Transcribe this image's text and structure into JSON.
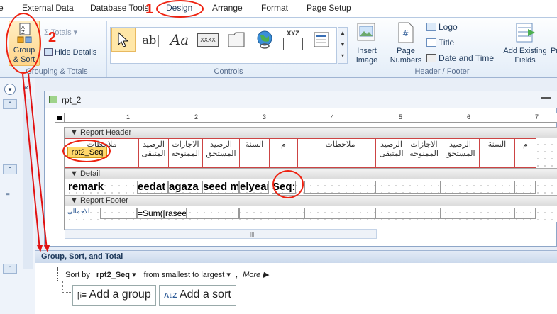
{
  "ribbon_tabs": [
    {
      "label": "e"
    },
    {
      "label": "External Data"
    },
    {
      "label": "Database Tools"
    },
    {
      "label": "Design"
    },
    {
      "label": "Arrange"
    },
    {
      "label": "Format"
    },
    {
      "label": "Page Setup"
    }
  ],
  "grouping": {
    "group_sort_label": "Group\n& Sort",
    "totals_label": "Totals",
    "hide_details_label": "Hide Details",
    "group_name": "Grouping & Totals"
  },
  "controls": {
    "group_name": "Controls",
    "textbox_label": "ab|",
    "label_label": "Aa",
    "button_label": "XXXX",
    "xyz_label": "XYZ",
    "insert_image_label": "Insert\nImage"
  },
  "header_footer": {
    "group_name": "Header / Footer",
    "page_numbers_label": "Page\nNumbers",
    "logo_label": "Logo",
    "title_label": "Title",
    "date_time_label": "Date and Time"
  },
  "tools": {
    "add_existing_fields_label": "Add Existing\nFields",
    "partial_label": "Pr"
  },
  "report": {
    "window_title": "rpt_2",
    "ruler_marks": [
      "1",
      "2",
      "3",
      "4",
      "5",
      "6",
      "7"
    ],
    "report_header_label": "Report Header",
    "detail_label": "Detail",
    "report_footer_label": "Report Footer",
    "header_cells": [
      {
        "text": "ملاحظات"
      },
      {
        "text": "الرصيد المتبقى"
      },
      {
        "text": "الاجازات الممنوحة"
      },
      {
        "text": "الرصيد المستحق"
      },
      {
        "text": "السنة"
      },
      {
        "text": "م"
      },
      {
        "text": "ملاحظات"
      },
      {
        "text": "الرصيد المتبقى"
      },
      {
        "text": "الاجازات الممنوحة"
      },
      {
        "text": "الرصيد المستحق"
      },
      {
        "text": "السنة"
      },
      {
        "text": "م"
      }
    ],
    "header_selected_label": "rpt2_Seq",
    "detail_cells": [
      {
        "text": "remark"
      },
      {
        "text": "eedat"
      },
      {
        "text": "agaza"
      },
      {
        "text": "seed m"
      },
      {
        "text": "elyear"
      },
      {
        "text": "Seq:"
      }
    ],
    "footer_label": "الاجمالى",
    "footer_expr": "=Sum([rasee"
  },
  "group_sort_pane": {
    "title": "Group, Sort, and Total",
    "sort_by_label": "Sort by",
    "sort_field": "rpt2_Seq",
    "sort_order": "from smallest to largest",
    "more_label": "More ▶",
    "add_group_label": "Add a group",
    "add_sort_label": "Add a sort"
  },
  "annotations": {
    "step1": "1",
    "step2": "2"
  },
  "colors": {
    "annotation_red": "#e21111",
    "selected_label_bg": "#ffd86b"
  }
}
